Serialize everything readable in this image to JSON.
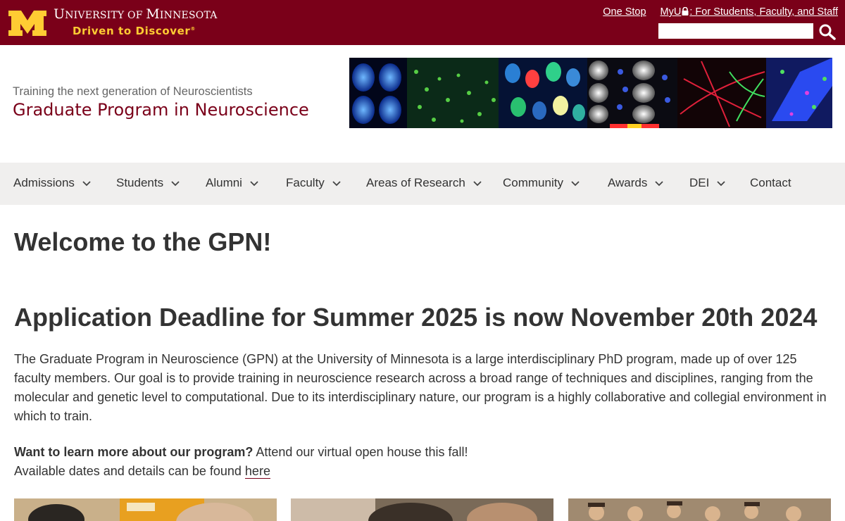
{
  "topbar": {
    "university_first": "U",
    "university_rest": "niversity of ",
    "university_m": "M",
    "university_last": "innesota",
    "tagline": "Driven to Discover",
    "tagline_mark": "®",
    "links": {
      "one_stop": "One Stop",
      "myu_prefix": "MyU",
      "myu_suffix": ": For Students, Faculty, and Staff"
    },
    "search": {
      "placeholder": "",
      "value": ""
    }
  },
  "site": {
    "subtitle": "Training the next generation of Neuroscientists",
    "title": "Graduate Program in Neuroscience"
  },
  "nav": {
    "items": [
      {
        "label": "Admissions",
        "has_menu": true
      },
      {
        "label": "Students",
        "has_menu": true
      },
      {
        "label": "Alumni",
        "has_menu": true
      },
      {
        "label": "Faculty",
        "has_menu": true
      },
      {
        "label": "Areas of Research",
        "has_menu": true
      },
      {
        "label": "Community",
        "has_menu": true
      },
      {
        "label": "Awards",
        "has_menu": true
      },
      {
        "label": "DEI",
        "has_menu": true
      },
      {
        "label": "Contact",
        "has_menu": false
      }
    ]
  },
  "main": {
    "welcome": "Welcome to the GPN!",
    "deadline_prefix": "Application Deadline for Summer 2025 is now ",
    "deadline_bold": "November 20th 2024",
    "intro": "The Graduate Program in Neuroscience (GPN) at the University of Minnesota is a large interdisciplinary PhD program, made up of over 125 faculty members. Our goal is to provide training in neuroscience research across a broad range of techniques and disciplines, ranging from the molecular and genetic level to computational. Due to its interdisciplinary nature, our program is a highly collaborative and collegial environment in which to train.",
    "learn_bold": "Want to learn more about our program?",
    "learn_rest": " Attend our virtual open house this fall!",
    "dates_text": "Available dates and details can be found ",
    "here_link": "here"
  },
  "colors": {
    "maroon": "#7a0019",
    "gold": "#ffcc33",
    "nav_bg": "#f0efee",
    "text": "#333333"
  },
  "icons": {
    "logo": "block-m-logo",
    "lock": "lock-icon",
    "search": "search-icon",
    "chevron": "chevron-down-icon"
  }
}
